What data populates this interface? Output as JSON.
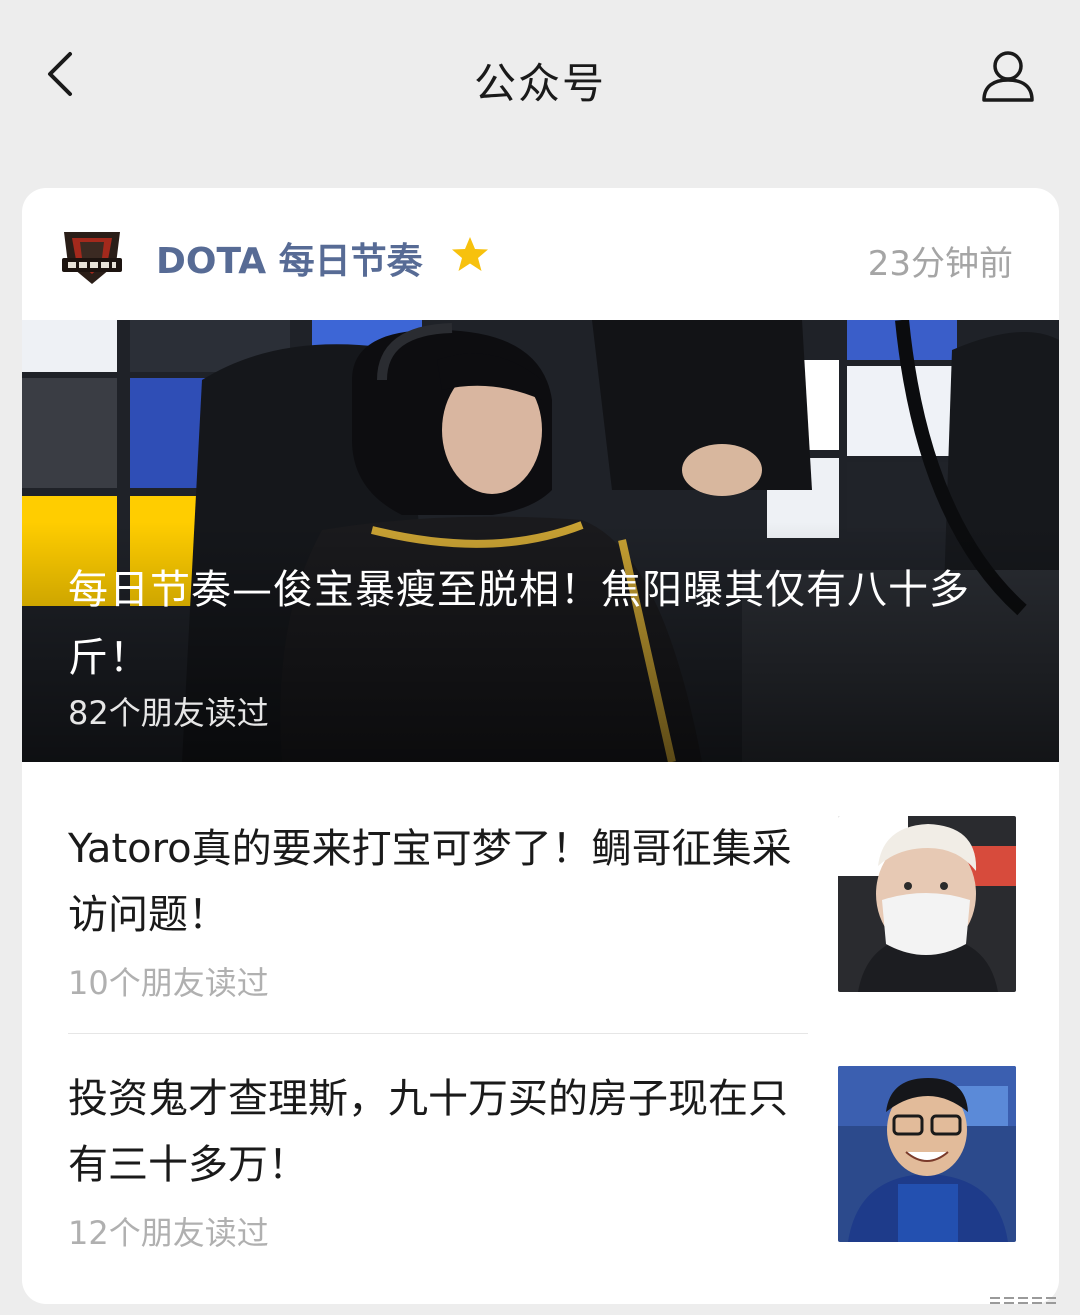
{
  "nav": {
    "title": "公众号",
    "back_icon": "chevron-left-icon",
    "profile_icon": "person-icon"
  },
  "account": {
    "logo_text": "每日节奏",
    "name": "DOTA 每日节奏",
    "star_icon": "star-icon",
    "star_color": "#f7c10d",
    "time": "23分钟前",
    "name_color": "#576b95"
  },
  "hero_article": {
    "title": "每日节奏—俊宝暴瘦至脱相！焦阳曝其仅有八十多斤！",
    "readers": "82个朋友读过"
  },
  "articles": [
    {
      "title": "Yatoro真的要来打宝可梦了！鲷哥征集采访问题！",
      "readers": "10个朋友读过"
    },
    {
      "title": "投资鬼才查理斯，九十万买的房子现在只有三十多万！",
      "readers": "12个朋友读过"
    }
  ]
}
